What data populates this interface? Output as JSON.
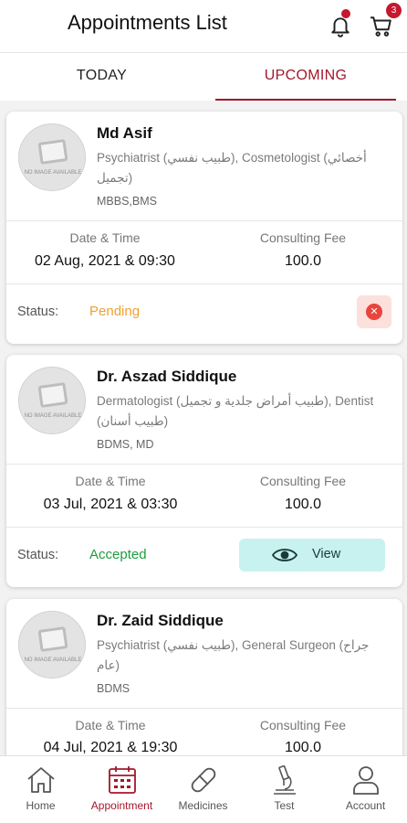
{
  "header": {
    "title": "Appointments List",
    "cart_count": "3"
  },
  "tabs": [
    {
      "label": "TODAY"
    },
    {
      "label": "UPCOMING"
    }
  ],
  "common": {
    "no_image": "NO IMAGE AVAILABLE",
    "date_time_label": "Date & Time",
    "fee_label": "Consulting Fee",
    "status_label": "Status:",
    "view_label": "View"
  },
  "appointments": [
    {
      "name": "Md Asif",
      "specialty": "Psychiatrist (طبيب نفسي), Cosmetologist (أخصائي تجميل)",
      "degree": "MBBS,BMS",
      "datetime": "02 Aug, 2021 & 09:30",
      "fee": "100.0",
      "status": "Pending"
    },
    {
      "name": "Dr. Aszad Siddique",
      "specialty": "Dermatologist (طبيب أمراض جلدية و تجميل), Dentist (طبيب أسنان)",
      "degree": "BDMS, MD",
      "datetime": "03 Jul, 2021 & 03:30",
      "fee": "100.0",
      "status": "Accepted"
    },
    {
      "name": "Dr. Zaid Siddique",
      "specialty": "Psychiatrist (طبيب نفسي), General Surgeon (جراح عام)",
      "degree": "BDMS",
      "datetime": "04 Jul, 2021 & 19:30",
      "fee": "100.0"
    }
  ],
  "colors": {
    "brand": "#a3172b",
    "pending": "#f0a030",
    "accepted": "#1e9e3e",
    "view_bg": "#c8f2ef"
  },
  "nav": [
    {
      "label": "Home",
      "icon": "home-icon"
    },
    {
      "label": "Appointment",
      "icon": "calendar-icon"
    },
    {
      "label": "Medicines",
      "icon": "pill-icon"
    },
    {
      "label": "Test",
      "icon": "microscope-icon"
    },
    {
      "label": "Account",
      "icon": "user-icon"
    }
  ]
}
